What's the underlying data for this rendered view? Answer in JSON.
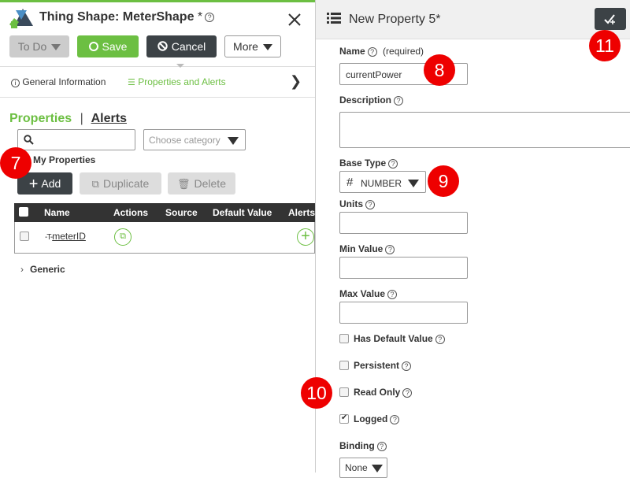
{
  "left": {
    "title": "Thing Shape: MeterShape",
    "title_modified": "*",
    "toolbar": {
      "todo_label": "To Do",
      "save_label": "Save",
      "cancel_label": "Cancel",
      "more_label": "More"
    },
    "tabs": {
      "general": "General Information",
      "properties": "Properties and Alerts"
    },
    "subtabs": {
      "properties": "Properties",
      "separator": "|",
      "alerts": "Alerts"
    },
    "search_placeholder": "",
    "category_placeholder": "Choose category",
    "group_label": "My Properties",
    "actions": {
      "add": "Add",
      "duplicate": "Duplicate",
      "delete": "Delete"
    },
    "table": {
      "columns": [
        "Name",
        "Actions",
        "Source",
        "Default Value",
        "Alerts"
      ],
      "rows": [
        {
          "name": "meterID"
        }
      ]
    },
    "generic_label": "Generic"
  },
  "right": {
    "title": "New Property 5",
    "title_modified": "*",
    "name_label": "Name",
    "name_required": "(required)",
    "name_value": "currentPower",
    "description_label": "Description",
    "base_type_label": "Base Type",
    "base_type_symbol": "#",
    "base_type_value": "NUMBER",
    "units_label": "Units",
    "min_label": "Min Value",
    "max_label": "Max Value",
    "has_default_label": "Has Default Value",
    "persistent_label": "Persistent",
    "read_only_label": "Read Only",
    "logged_label": "Logged",
    "logged_checked": true,
    "binding_label": "Binding",
    "binding_value": "None"
  },
  "badges": {
    "b7": "7",
    "b8": "8",
    "b9": "9",
    "b10": "10",
    "b11": "11"
  },
  "colors": {
    "accent_green": "#6cbf42",
    "dark_button": "#3c4246",
    "badge_red": "#e00000"
  }
}
